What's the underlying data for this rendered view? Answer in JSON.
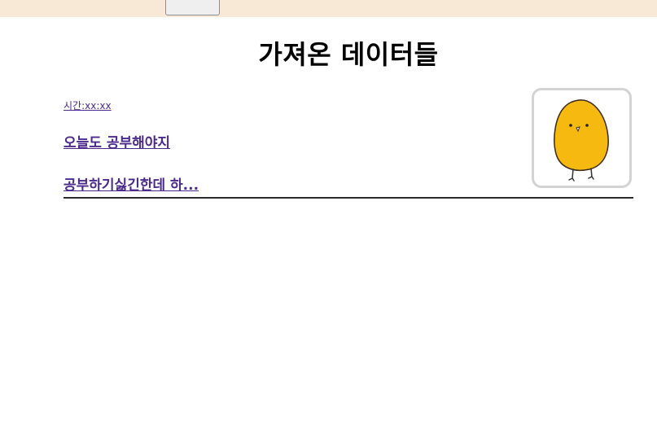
{
  "header": {
    "button_label": ""
  },
  "main": {
    "title": "가져온 데이터들",
    "posts": [
      {
        "time": "시간:xx:xx",
        "title": "오늘도 공부해야지",
        "content": "공부하기싫긴한데 하...",
        "image": "yellow-chick-icon"
      }
    ]
  },
  "colors": {
    "topbar": "#f8e8d6",
    "link": "#4b2a8c",
    "chick": "#f6b90f"
  }
}
